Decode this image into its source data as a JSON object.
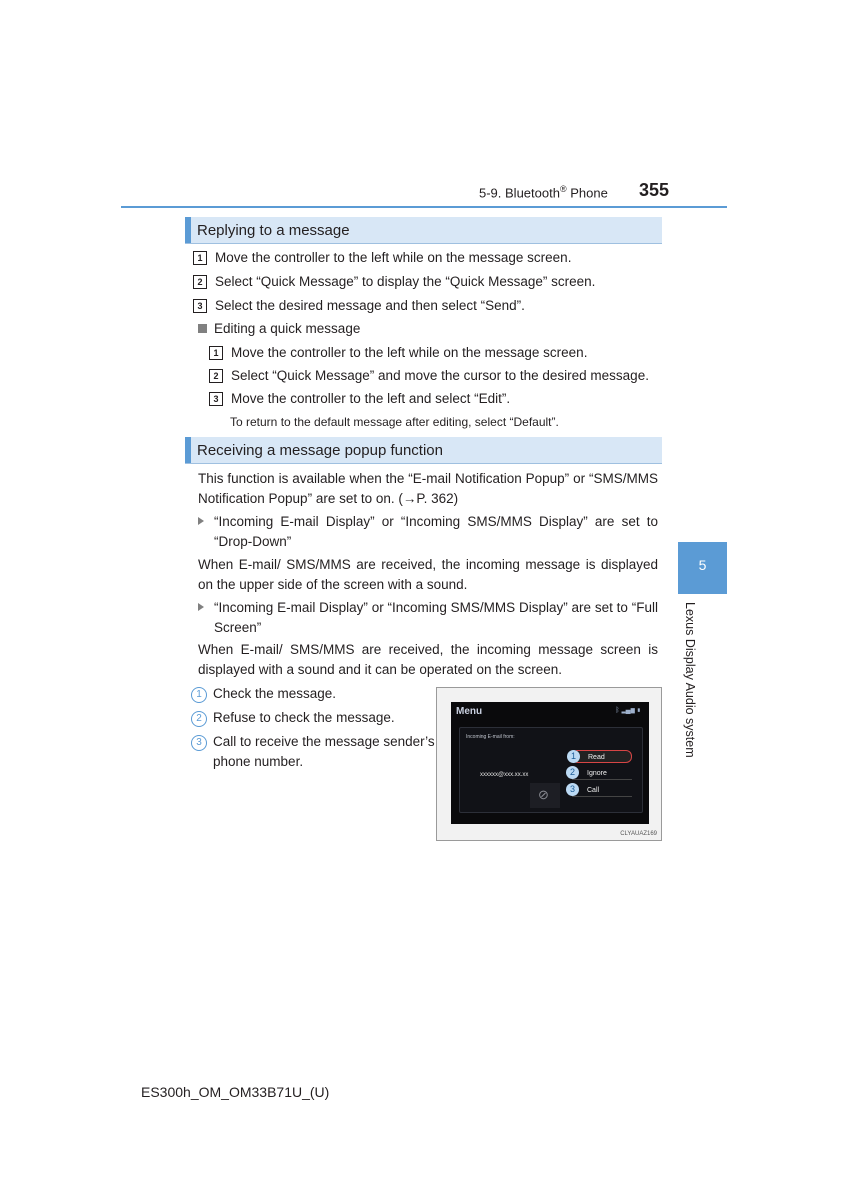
{
  "header": {
    "section": "5-9. Bluetooth",
    "section_sup": "®",
    "section_suffix": " Phone",
    "page_number": "355"
  },
  "replying": {
    "title": "Replying to a message",
    "steps": [
      {
        "n": "1",
        "text": "Move the controller to the left while on the message screen."
      },
      {
        "n": "2",
        "text": "Select “Quick Message” to display the “Quick Message” screen."
      },
      {
        "n": "3",
        "text": "Select the desired message and then select “Send”."
      }
    ],
    "sub_title": "Editing a quick message",
    "sub_steps": [
      {
        "n": "1",
        "text": "Move the controller to the left while on the message screen."
      },
      {
        "n": "2",
        "text": "Select “Quick Message” and move the cursor to the desired message."
      },
      {
        "n": "3",
        "text": "Move the controller to the left and select “Edit”."
      }
    ],
    "note": "To return to the default message after editing, select “Default”."
  },
  "receiving": {
    "title": "Receiving a message popup function",
    "intro": "This function is available when the “E-mail Notification Popup” or “SMS/MMS Notification Popup” are set to on. (→P. 362)",
    "bullet1": "“Incoming E-mail Display” or “Incoming SMS/MMS Display” are set to “Drop-Down”",
    "para1": "When E-mail/ SMS/MMS are received, the incoming message is displayed on the upper side of the screen with a sound.",
    "bullet2": "“Incoming E-mail Display” or “Incoming SMS/MMS Display” are set to “Full Screen”",
    "para2": "When E-mail/ SMS/MMS are received, the incoming message screen is displayed with a sound and it can be operated on the screen.",
    "callouts": [
      {
        "n": "1",
        "text": "Check the message."
      },
      {
        "n": "2",
        "text": "Refuse to check the message."
      },
      {
        "n": "3",
        "text": "Call to receive the message sender’s phone number."
      }
    ]
  },
  "figure": {
    "screen_title": "Menu",
    "status_icons": "bluetooth signal battery",
    "incoming_label": "Incoming E-mail from:",
    "address": "xxxxxx@xxx.xx.xx",
    "blocked_icon": "⊘",
    "options": [
      {
        "n": "1",
        "label": "Read"
      },
      {
        "n": "2",
        "label": "Ignore"
      },
      {
        "n": "3",
        "label": "Call"
      }
    ],
    "caption": "CLYAUAZ169"
  },
  "side_tab": {
    "chapter": "5",
    "label": "Lexus Display Audio system"
  },
  "footer": "ES300h_OM_OM33B71U_(U)"
}
